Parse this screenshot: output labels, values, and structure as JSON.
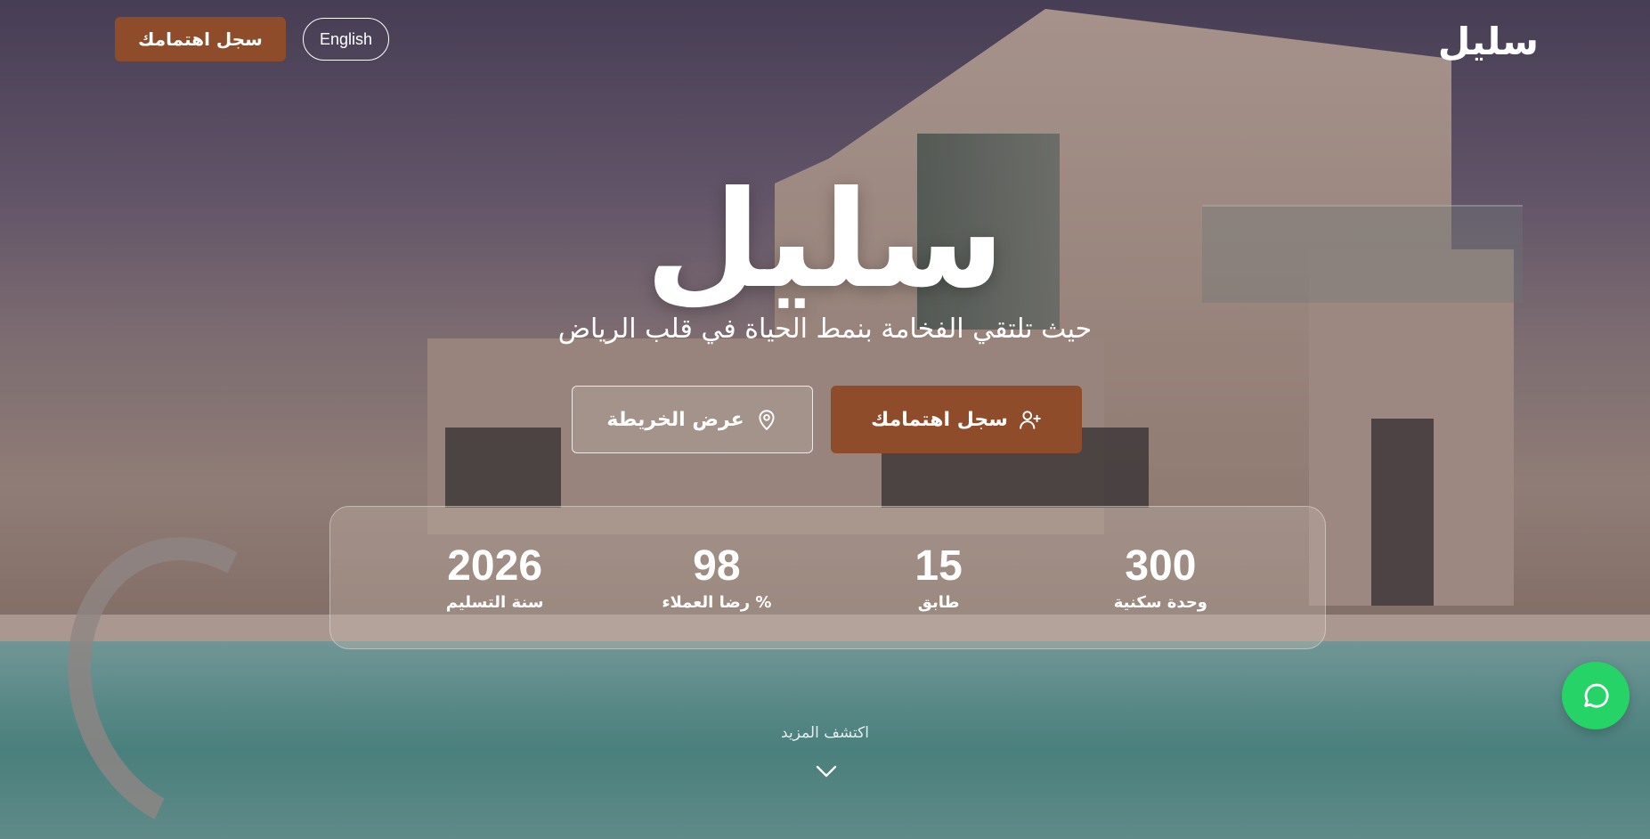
{
  "header": {
    "logo": "سليل",
    "lang_button": "English",
    "cta": "سجل اهتمامك"
  },
  "hero": {
    "title": "سليل",
    "subtitle": "حيث تلتقي الفخامة بنمط الحياة في قلب الرياض",
    "primary_button": "سجل اهتمامك",
    "secondary_button": "عرض الخريطة"
  },
  "stats": [
    {
      "value": "300",
      "label": "وحدة سكنية"
    },
    {
      "value": "15",
      "label": "طابق"
    },
    {
      "value": "98",
      "label": "% رضا العملاء"
    },
    {
      "value": "2026",
      "label": "سنة التسليم"
    }
  ],
  "explore": {
    "label": "اكتشف المزيد"
  },
  "icons": {
    "primary_button": "user-plus-icon",
    "secondary_button": "map-pin-icon",
    "scroll": "chevron-down-icon",
    "floating": "whatsapp-icon"
  },
  "colors": {
    "accent": "#8f4c2a",
    "whatsapp": "#25d366"
  }
}
